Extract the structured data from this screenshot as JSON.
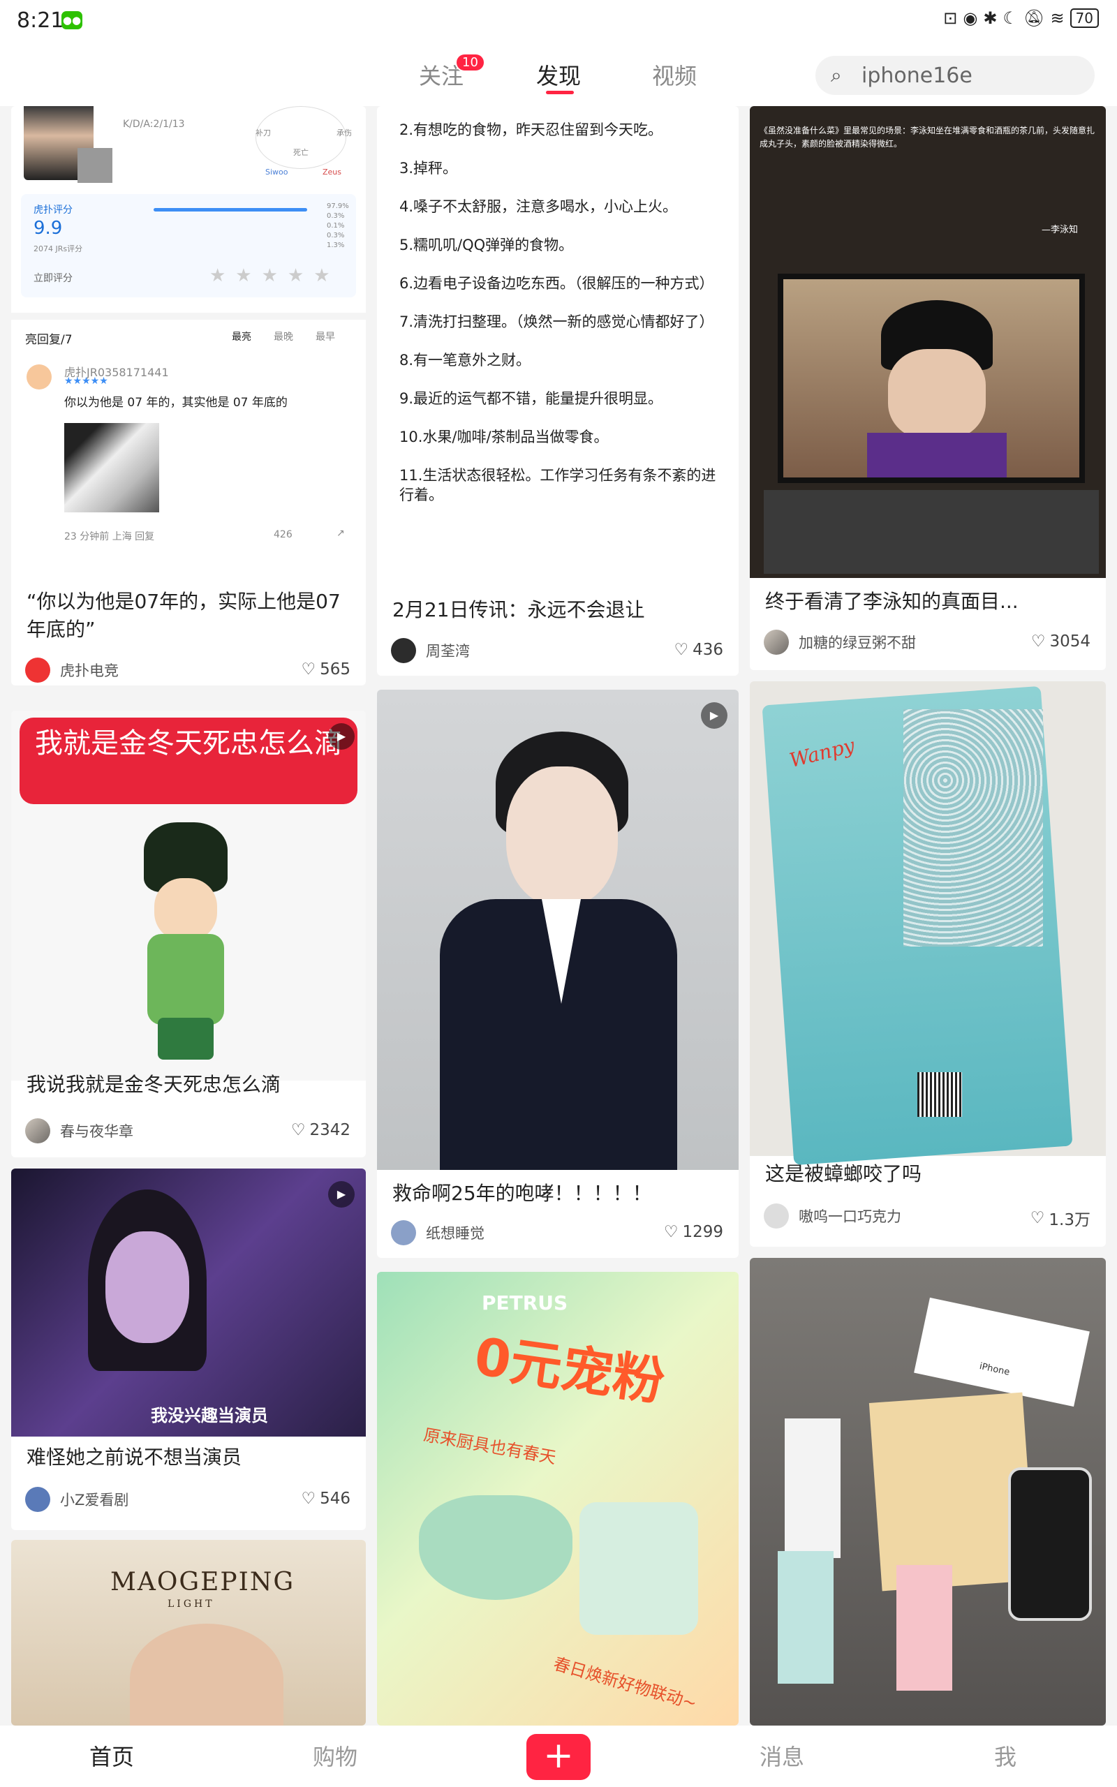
{
  "status": {
    "time": "8:21",
    "battery": "70"
  },
  "tabs": [
    {
      "label": "关注",
      "badge": "10"
    },
    {
      "label": "发现"
    },
    {
      "label": "视频"
    }
  ],
  "search": {
    "placeholder": "iphone16e"
  },
  "cards": {
    "c1": {
      "title": "“你以为他是07年的，实际上他是07年底的”",
      "user": "虎扑电竞",
      "likes": "565",
      "meta": "K/D/A:2/1/13",
      "radar": "补刀",
      "radar2": "承伤",
      "radar3": "死亡",
      "legend1": "Siwoo",
      "legend2": "Zeus",
      "rating": "9.9",
      "rating_count": "2074 JRs评分",
      "rating_brand": "虎扑评分",
      "rate_now": "立即评分",
      "pct1": "97.9%",
      "pct2": "0.3%",
      "pct3": "0.1%",
      "pct4": "0.3%",
      "pct5": "1.3%",
      "replies": "亮回复/7",
      "sort1": "最亮",
      "sort2": "最晚",
      "sort3": "最早",
      "reply_user": "虎扑JR0358171441",
      "reply_text": "你以为他是 07 年的，其实他是 07 年底的",
      "reply_time": "23 分钟前 上海 回复",
      "reply_likes": "426"
    },
    "c2": {
      "title": "我说我就是金冬天死忠怎么滴",
      "user": "春与夜华章",
      "likes": "2342",
      "banner": "我就是金冬天死忠怎么滴"
    },
    "c3": {
      "title": "难怪她之前说不想当演员",
      "user": "小Z爱看剧",
      "likes": "546",
      "caption": "我没兴趣当演员"
    },
    "c4": {
      "brand": "MAOGEPING",
      "brand_sub": "LIGHT"
    },
    "c5": {
      "title": "2月21日传讯：永远不会退让",
      "user": "周荃湾",
      "likes": "436",
      "lines": [
        "2.有想吃的食物，昨天忍住留到今天吃。",
        "3.掉秤。",
        "4.嗓子不太舒服，注意多喝水，小心上火。",
        "5.糯叽叽/QQ弹弹的食物。",
        "6.边看电子设备边吃东西。（很解压的一种方式）",
        "7.清洗打扫整理。（焕然一新的感觉心情都好了）",
        "8.有一笔意外之财。",
        "9.最近的运气都不错，能量提升很明显。",
        "10.水果/咖啡/茶制品当做零食。",
        "11.生活状态很轻松。工作学习任务有条不紊的进行着。"
      ]
    },
    "c6": {
      "title": "救命啊25年的咆哮！！！！！",
      "user": "纸想睡觉",
      "likes": "1299"
    },
    "c7": {
      "brand": "PETRUS",
      "headline": "0元宠粉",
      "sub1": "原来厨具也有春天",
      "sub2": "春日焕新好物联动~"
    },
    "c8": {
      "title": "终于看清了李泳知的真面目...",
      "user": "加糖的绿豆粥不甜",
      "likes": "3054",
      "caption": "《虽然没准备什么菜》里最常见的场景：李泳知坐在堆满零食和酒瓶的茶几前，头发随意扎成丸子头，素颜的脸被酒精染得微红。",
      "sign": "—李泳知"
    },
    "c9": {
      "title": "这是被蟑螂咬了吗",
      "user": "嗷呜一口巧克力",
      "likes": "1.3万",
      "brand": "Wanpy"
    },
    "c10": {
      "box": "iPhone"
    }
  },
  "bottom": {
    "home": "首页",
    "shop": "购物",
    "plus": "+",
    "msg": "消息",
    "me": "我"
  },
  "colors": {
    "accent": "#ff2442"
  }
}
